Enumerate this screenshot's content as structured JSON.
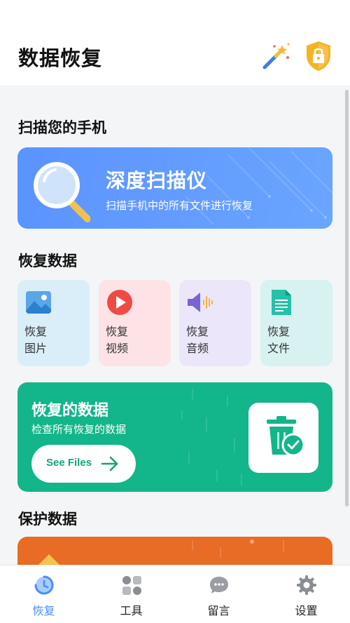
{
  "header": {
    "title": "数据恢复"
  },
  "scan_section": {
    "title": "扫描您的手机",
    "card_title": "深度扫描仪",
    "card_subtitle": "扫描手机中的所有文件进行恢复"
  },
  "recover_section": {
    "title": "恢复数据",
    "tiles": [
      {
        "label": "恢复\n图片",
        "icon": "image-icon",
        "bg": "#d9eef8"
      },
      {
        "label": "恢复\n视频",
        "icon": "video-play-icon",
        "bg": "#fde3e6"
      },
      {
        "label": "恢复\n音频",
        "icon": "audio-speaker-icon",
        "bg": "#ebe6fa"
      },
      {
        "label": "恢复\n文件",
        "icon": "document-icon",
        "bg": "#d8f1f1"
      }
    ]
  },
  "recovered_card": {
    "title": "恢复的数据",
    "subtitle": "检查所有恢复的数据",
    "button_label": "See Files",
    "color": "#13b58a"
  },
  "protect_section": {
    "title": "保护数据",
    "color": "#e86b26"
  },
  "bottom_nav": {
    "items": [
      {
        "label": "恢复",
        "icon": "recover-clock-icon",
        "active": true
      },
      {
        "label": "工具",
        "icon": "tools-grid-icon",
        "active": false
      },
      {
        "label": "留言",
        "icon": "chat-bubble-icon",
        "active": false
      },
      {
        "label": "设置",
        "icon": "gear-icon",
        "active": false
      }
    ]
  },
  "colors": {
    "accent": "#4a8df8",
    "scan_card": "#5b93ff"
  }
}
